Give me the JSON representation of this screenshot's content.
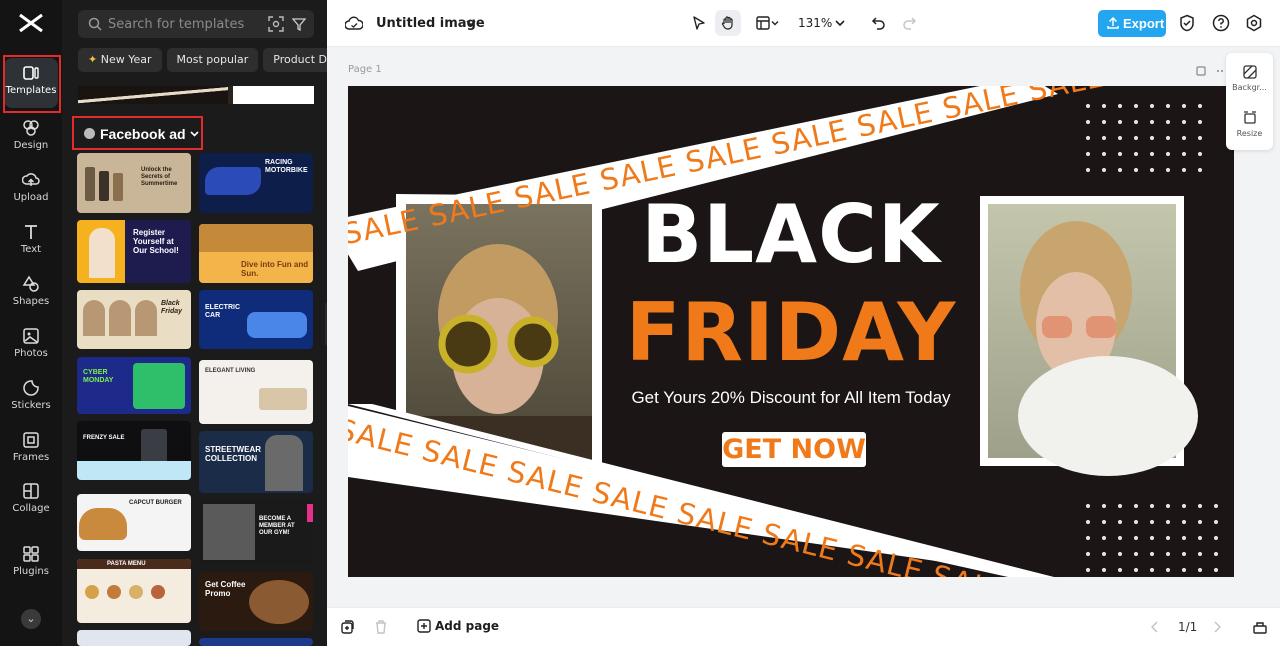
{
  "rail": {
    "items": [
      {
        "label": "Templates",
        "icon": "templates-icon"
      },
      {
        "label": "Design",
        "icon": "design-icon"
      },
      {
        "label": "Upload",
        "icon": "upload-icon"
      },
      {
        "label": "Text",
        "icon": "text-icon"
      },
      {
        "label": "Shapes",
        "icon": "shapes-icon"
      },
      {
        "label": "Photos",
        "icon": "photos-icon"
      },
      {
        "label": "Stickers",
        "icon": "stickers-icon"
      },
      {
        "label": "Frames",
        "icon": "frames-icon"
      },
      {
        "label": "Collage",
        "icon": "collage-icon"
      },
      {
        "label": "Plugins",
        "icon": "plugins-icon"
      }
    ]
  },
  "panel": {
    "search_placeholder": "Search for templates",
    "chips": [
      "New Year",
      "Most popular",
      "Product D"
    ],
    "section_title": "Facebook ad",
    "thumbnails": [
      {
        "text": "Unlock the Secrets of Summertime"
      },
      {
        "text": "RACING MOTORBIKE"
      },
      {
        "text": "Register Yourself at Our School!"
      },
      {
        "text": "Dive into Fun and Sun."
      },
      {
        "text": "Black Friday"
      },
      {
        "text": "ELECTRIC CAR"
      },
      {
        "text": "CYBER MONDAY"
      },
      {
        "text": "ELEGANT LIVING"
      },
      {
        "text": "FRENZY SALE"
      },
      {
        "text": "STREETWEAR COLLECTION"
      },
      {
        "text": "CAPCUT BURGER"
      },
      {
        "text": "BECOME A MEMBER AT OUR GYM!"
      },
      {
        "text": "PASTA MENU"
      },
      {
        "text": "Get Coffee Promo"
      }
    ]
  },
  "topbar": {
    "doc_title": "Untitled image",
    "zoom": "131%",
    "export_label": "Export"
  },
  "canvas": {
    "page_label": "Page 1",
    "design": {
      "sale_word": "SALE",
      "headline_1": "BLACK",
      "headline_2": "FRIDAY",
      "subline": "Get Yours 20% Discount for All Item Today",
      "cta": "GET NOW"
    },
    "right_panel": [
      {
        "label": "Backgr...",
        "icon": "background-icon"
      },
      {
        "label": "Resize",
        "icon": "resize-icon"
      }
    ]
  },
  "bottombar": {
    "add_page": "Add page",
    "page_count": "1/1"
  },
  "colors": {
    "accent": "#23a6ef",
    "highlight": "#e42a2a",
    "orange": "#f07a1a",
    "design_bg": "#1b1516"
  }
}
